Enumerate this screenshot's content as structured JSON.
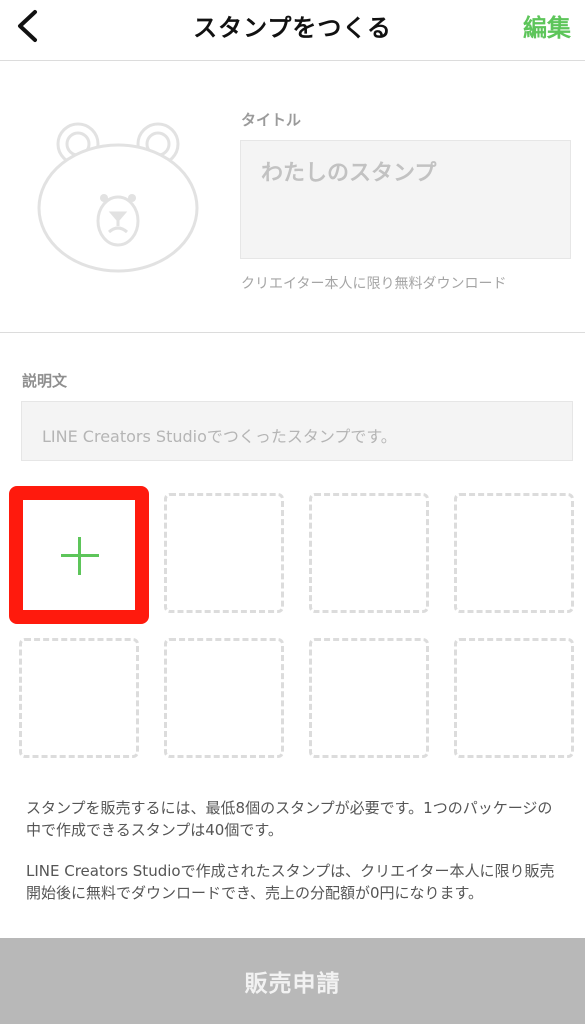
{
  "header": {
    "title": "スタンプをつくる",
    "edit_label": "編集",
    "back_icon": "chevron-left-icon"
  },
  "sticker_set": {
    "main_image_icon": "bear-placeholder-icon",
    "title_label": "タイトル",
    "title_placeholder": "わたしのスタンプ",
    "title_note": "クリエイター本人に限り無料ダウンロード",
    "description_label": "説明文",
    "description_placeholder": "LINE Creators Studioでつくったスタンプです。"
  },
  "grid": {
    "add_icon": "plus-icon",
    "slot_count": 8
  },
  "info": {
    "line1": "スタンプを販売するには、最低8個のスタンプが必要です。1つのパッケージの中で作成できるスタンプは40個です。",
    "line2": "LINE Creators Studioで作成されたスタンプは、クリエイター本人に限り販売開始後に無料でダウンロードでき、売上の分配額が0円になります。"
  },
  "footer": {
    "submit_label": "販売申請"
  },
  "colors": {
    "accent": "#5dc55a",
    "highlight": "#ff1a0d",
    "button_disabled": "#b8b8b8"
  }
}
